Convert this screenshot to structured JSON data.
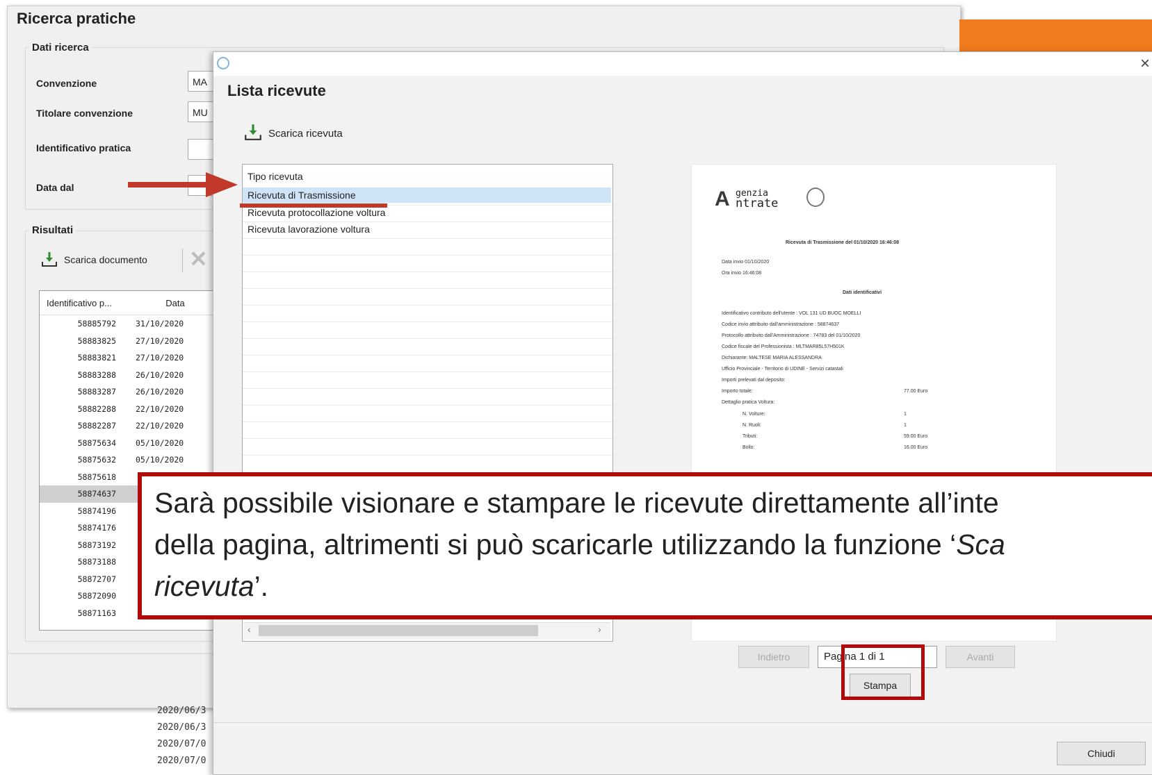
{
  "bg_window": {
    "title": "Ricerca pratiche",
    "group_label": "Dati ricerca",
    "fields": [
      {
        "label": "Convenzione",
        "value": "MA"
      },
      {
        "label": "Titolare convenzione",
        "value": "MU"
      },
      {
        "label": "Identificativo pratica",
        "value": ""
      },
      {
        "label": "Data dal",
        "value": ""
      }
    ],
    "results_label": "Risultati",
    "scarica_documento": "Scarica documento",
    "table_headers": [
      "Identificativo p...",
      "Data"
    ],
    "rows": [
      {
        "id": "58885792",
        "date": "31/10/2020"
      },
      {
        "id": "58883825",
        "date": "27/10/2020"
      },
      {
        "id": "58883821",
        "date": "27/10/2020"
      },
      {
        "id": "58883288",
        "date": "26/10/2020"
      },
      {
        "id": "58883287",
        "date": "26/10/2020"
      },
      {
        "id": "58882288",
        "date": "22/10/2020"
      },
      {
        "id": "58882287",
        "date": "22/10/2020"
      },
      {
        "id": "58875634",
        "date": "05/10/2020"
      },
      {
        "id": "58875632",
        "date": "05/10/2020"
      },
      {
        "id": "58875618",
        "date": ""
      },
      {
        "id": "58874637",
        "date": ""
      },
      {
        "id": "58874196",
        "date": ""
      },
      {
        "id": "58874176",
        "date": ""
      },
      {
        "id": "58873192",
        "date": ""
      },
      {
        "id": "58873188",
        "date": ""
      },
      {
        "id": "58872707",
        "date": ""
      },
      {
        "id": "58872090",
        "date": ""
      },
      {
        "id": "58871163",
        "date": ""
      }
    ],
    "selected_row_index": 10,
    "years": [
      "2020/06/3",
      "2020/06/3",
      "2020/07/0",
      "2020/07/0"
    ]
  },
  "dialog": {
    "title": "Lista ricevute",
    "scarica_ricevuta": "Scarica ricevuta",
    "list_items": [
      "Tipo ricevuta",
      "Ricevuta di Trasmissione",
      "Ricevuta protocollazione voltura",
      "Ricevuta lavorazione voltura"
    ],
    "selected_item_index": 1,
    "pagination": {
      "prev": "Indietro",
      "page": "Pagina 1 di 1",
      "next": "Avanti"
    },
    "stampa": "Stampa",
    "chiudi": "Chiudi",
    "close_glyph": "×"
  },
  "preview_doc": {
    "logo_letter": "A",
    "logo_text": "genzia\nntrate",
    "logo_line1": "genzia",
    "logo_line2": "ntrate",
    "heading": "Ricevuta di Trasmissione del 01/10/2020 16:46:08",
    "date_sent": "Data invio 01/10/2020",
    "time_sent": "Ora invio 16:46:08",
    "section": "Dati identificativi",
    "lines": [
      "Identificativo contributo dell'utente : VOL 131 UD BUOC MOELLI",
      "Codice invio attribuito dall'amministrazione : 58874637",
      "Protocollo attribuito dall'Amministrazione : 74783 del 01/10/2020",
      "Codice fiscale del Professionista : MLTMAR85L57H501K",
      "Dichiarante: MALTESE MARIA ALESSANDRA",
      "Ufficio Provinciale - Territorio di UDINE - Servizi catastali",
      "Importi prelevati dal deposito:",
      "Importo totale:",
      "Dettaglio pratica Voltura:"
    ],
    "amount_total": "77.00 Euro",
    "details": [
      {
        "label": "N. Volture:",
        "value": "1"
      },
      {
        "label": "N. Ruoli:",
        "value": "1"
      },
      {
        "label": "Tributi:",
        "value": "59.00 Euro"
      },
      {
        "label": "Bollo:",
        "value": "16.00 Euro"
      }
    ]
  },
  "callout": {
    "line1": "Sarà possibile visionare e stampare le ricevute direttamente all’inte",
    "line2_prefix": "della pagina, altrimenti si può scaricarle utilizzando la funzione ‘",
    "line2_italic": "Sca",
    "line3_italic": "ricevuta",
    "line3_suffix": "’."
  },
  "colors": {
    "annotation_red": "#b00a0a",
    "arrow_red": "#c0392b",
    "banner_orange": "#f07a1e",
    "selection_blue": "#cfe4f7"
  }
}
